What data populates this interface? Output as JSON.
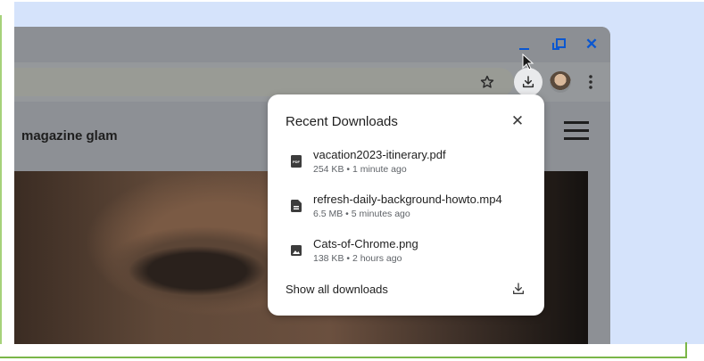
{
  "toolbar": {
    "bookmark_icon": "star-icon",
    "downloads_icon": "download-icon",
    "menu_icon": "more-vert-icon"
  },
  "window_controls": {
    "minimize_icon": "minimize-icon",
    "restore_icon": "restore-icon",
    "close_glyph": "✕"
  },
  "site": {
    "title": "magazine glam",
    "menu_icon": "hamburger-icon"
  },
  "downloads_popup": {
    "title": "Recent Downloads",
    "close_glyph": "✕",
    "items": [
      {
        "name": "vacation2023-itinerary.pdf",
        "meta": "254 KB • 1 minute ago",
        "icon": "pdf-file-icon"
      },
      {
        "name": "refresh-daily-background-howto.mp4",
        "meta": "6.5 MB • 5 minutes ago",
        "icon": "document-file-icon"
      },
      {
        "name": "Cats-of-Chrome.png",
        "meta": "138 KB • 2 hours ago",
        "icon": "image-file-icon"
      }
    ],
    "show_all_label": "Show all downloads",
    "show_all_icon": "download-icon"
  },
  "colors": {
    "accent": "#0b57d0",
    "backdrop": "#d5e3fb",
    "frame_line": "#7ab648",
    "popup_bg": "#ffffff"
  }
}
